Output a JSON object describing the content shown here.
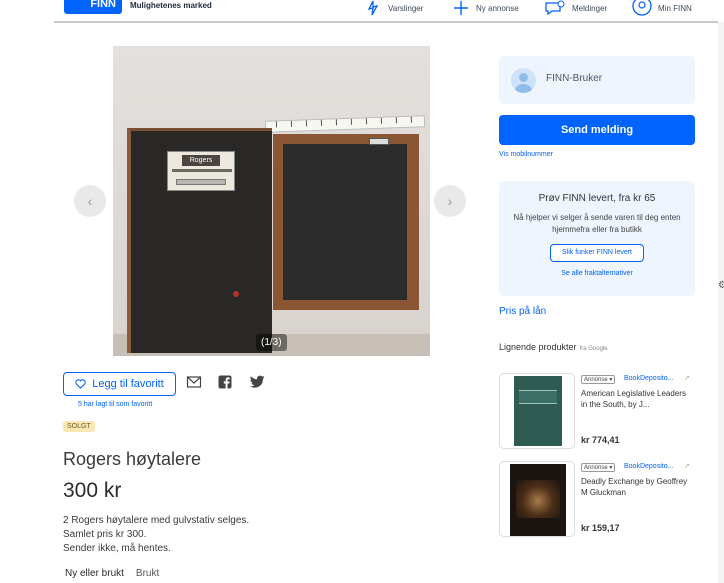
{
  "header": {
    "logo": "FINN",
    "tagline": "Mulighetenes marked",
    "nav": [
      {
        "label": "Varslinger",
        "icon": "bell-icon"
      },
      {
        "label": "Ny annonse",
        "icon": "plus-icon"
      },
      {
        "label": "Meldinger",
        "icon": "chat-icon"
      },
      {
        "label": "Min FINN",
        "icon": "user-icon"
      }
    ]
  },
  "gallery": {
    "counter": "(1/3)",
    "brand_label": "Rogers",
    "prev_label": "‹",
    "next_label": "›"
  },
  "actions": {
    "favorite_label": "Legg til favoritt",
    "favorite_count": "5 har lagt til som favoritt"
  },
  "listing": {
    "status": "SOLGT",
    "title": "Rogers høytalere",
    "price": "300 kr",
    "description": [
      "2 Rogers høytalere med gulvstativ selges.",
      "Samlet pris kr 300.",
      "Sender ikke, må hentes."
    ],
    "condition_label": "Ny eller brukt",
    "condition_value": "Brukt"
  },
  "sidebar": {
    "seller_name": "FINN-Bruker",
    "send_message": "Send melding",
    "show_mobile": "Vis mobilnummer",
    "shipping": {
      "title": "Prøv FINN levert, fra kr 65",
      "text": "Nå hjelper vi selger å sende varen til deg enten hjemmefra eller fra butikk",
      "button": "Slik funker FINN levert",
      "link": "Se alle fraktalternativer"
    },
    "loan_link": "Pris på lån",
    "similar_heading": "Lignende produkter",
    "similar_source": "fra Google",
    "products": [
      {
        "ad": "Annonse ▾",
        "store": "BookDeposito...",
        "name": "American Legislative Leaders in the South, by J...",
        "price": "kr 774,41"
      },
      {
        "ad": "Annonse ▾",
        "store": "BookDeposito...",
        "name": "Deadly Exchange by Geoffrey M Gluckman",
        "price": "kr 159,17"
      }
    ]
  },
  "colors": {
    "brand_blue": "#0063fb",
    "sold_badge": "#fbe8b4",
    "card_bg": "#eff5ff"
  }
}
